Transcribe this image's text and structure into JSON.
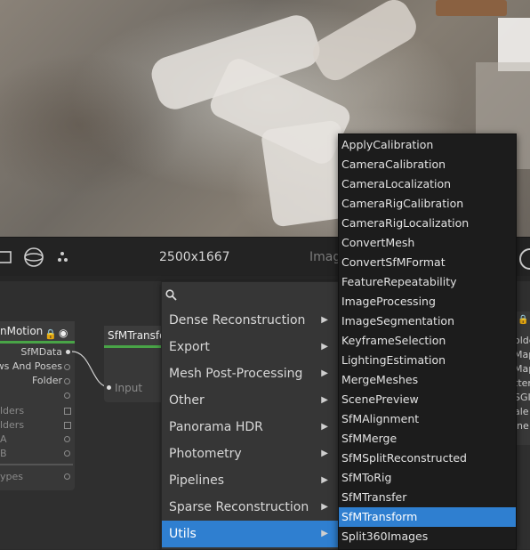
{
  "toolbar": {
    "resolution": "2500x1667",
    "partial_label": "Imag"
  },
  "nodes": {
    "left": {
      "title": "nMotion",
      "ports": [
        "SfMData",
        "ews And Poses",
        "Folder",
        "lders",
        "lders",
        "A",
        "B",
        "ypes"
      ]
    },
    "middle": {
      "title": "SfMTransfo",
      "input": "Input"
    },
    "right_fragments": [
      "olde",
      "Map",
      "Map",
      "tter",
      "SGI",
      "ale",
      "ine"
    ]
  },
  "category_menu": {
    "items": [
      {
        "label": "Dense Reconstruction"
      },
      {
        "label": "Export"
      },
      {
        "label": "Mesh Post-Processing"
      },
      {
        "label": "Other"
      },
      {
        "label": "Panorama HDR"
      },
      {
        "label": "Photometry"
      },
      {
        "label": "Pipelines"
      },
      {
        "label": "Sparse Reconstruction"
      },
      {
        "label": "Utils"
      }
    ],
    "selected": "Utils"
  },
  "utils_menu": {
    "items": [
      "ApplyCalibration",
      "CameraCalibration",
      "CameraLocalization",
      "CameraRigCalibration",
      "CameraRigLocalization",
      "ConvertMesh",
      "ConvertSfMFormat",
      "FeatureRepeatability",
      "ImageProcessing",
      "ImageSegmentation",
      "KeyframeSelection",
      "LightingEstimation",
      "MergeMeshes",
      "ScenePreview",
      "SfMAlignment",
      "SfMMerge",
      "SfMSplitReconstructed",
      "SfMToRig",
      "SfMTransfer",
      "SfMTransform",
      "Split360Images"
    ],
    "selected": "SfMTransform"
  },
  "colors": {
    "accent": "#2f7fd0",
    "node_status": "#49a447"
  }
}
